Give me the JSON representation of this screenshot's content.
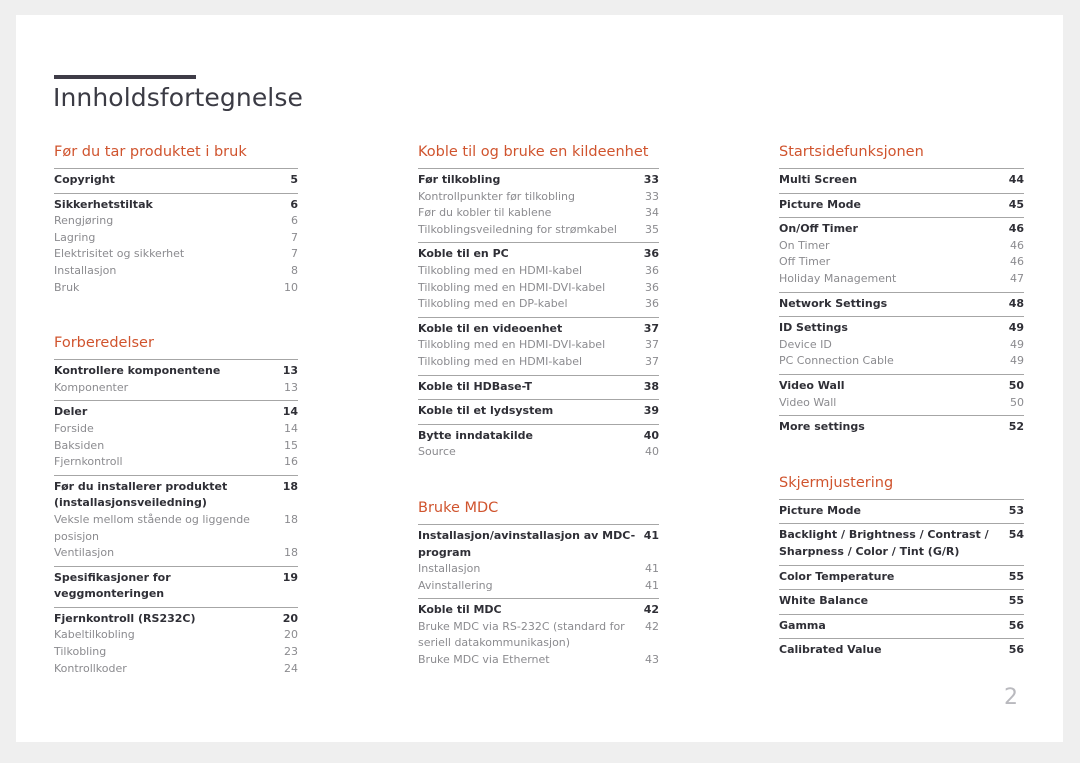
{
  "document": {
    "title": "Innholdsfortegnelse",
    "page_number": "2",
    "accent_color": "#d0542e",
    "rule_color": "#3e3c47"
  },
  "columns": [
    {
      "sections": [
        {
          "heading": "Før du tar produktet i bruk",
          "groups": [
            {
              "entries": [
                {
                  "label": "Copyright",
                  "page": "5",
                  "level": "main"
                }
              ]
            },
            {
              "entries": [
                {
                  "label": "Sikkerhetstiltak",
                  "page": "6",
                  "level": "main"
                },
                {
                  "label": "Rengjøring",
                  "page": "6",
                  "level": "sub"
                },
                {
                  "label": "Lagring",
                  "page": "7",
                  "level": "sub"
                },
                {
                  "label": "Elektrisitet og sikkerhet",
                  "page": "7",
                  "level": "sub"
                },
                {
                  "label": "Installasjon",
                  "page": "8",
                  "level": "sub"
                },
                {
                  "label": "Bruk",
                  "page": "10",
                  "level": "sub"
                }
              ]
            }
          ]
        },
        {
          "heading": "Forberedelser",
          "groups": [
            {
              "entries": [
                {
                  "label": "Kontrollere komponentene",
                  "page": "13",
                  "level": "main"
                },
                {
                  "label": "Komponenter",
                  "page": "13",
                  "level": "sub"
                }
              ]
            },
            {
              "entries": [
                {
                  "label": "Deler",
                  "page": "14",
                  "level": "main"
                },
                {
                  "label": "Forside",
                  "page": "14",
                  "level": "sub"
                },
                {
                  "label": "Baksiden",
                  "page": "15",
                  "level": "sub"
                },
                {
                  "label": "Fjernkontroll",
                  "page": "16",
                  "level": "sub"
                }
              ]
            },
            {
              "entries": [
                {
                  "label": "Før du installerer produktet (installasjonsveiledning)",
                  "page": "18",
                  "level": "main",
                  "wrap": true
                },
                {
                  "label": "Veksle mellom stående og liggende posisjon",
                  "page": "18",
                  "level": "sub"
                },
                {
                  "label": "Ventilasjon",
                  "page": "18",
                  "level": "sub"
                }
              ]
            },
            {
              "entries": [
                {
                  "label": "Spesifikasjoner for veggmonteringen",
                  "page": "19",
                  "level": "main"
                }
              ]
            },
            {
              "entries": [
                {
                  "label": "Fjernkontroll (RS232C)",
                  "page": "20",
                  "level": "main"
                },
                {
                  "label": "Kabeltilkobling",
                  "page": "20",
                  "level": "sub"
                },
                {
                  "label": "Tilkobling",
                  "page": "23",
                  "level": "sub"
                },
                {
                  "label": "Kontrollkoder",
                  "page": "24",
                  "level": "sub"
                }
              ]
            }
          ]
        }
      ]
    },
    {
      "sections": [
        {
          "heading": "Koble til og bruke en kildeenhet",
          "groups": [
            {
              "entries": [
                {
                  "label": "Før tilkobling",
                  "page": "33",
                  "level": "main"
                },
                {
                  "label": "Kontrollpunkter før tilkobling",
                  "page": "33",
                  "level": "sub"
                },
                {
                  "label": "Før du kobler til kablene",
                  "page": "34",
                  "level": "sub"
                },
                {
                  "label": "Tilkoblingsveiledning for strømkabel",
                  "page": "35",
                  "level": "sub"
                }
              ]
            },
            {
              "entries": [
                {
                  "label": "Koble til en PC",
                  "page": "36",
                  "level": "main"
                },
                {
                  "label": "Tilkobling med en HDMI-kabel",
                  "page": "36",
                  "level": "sub"
                },
                {
                  "label": "Tilkobling med en HDMI-DVI-kabel",
                  "page": "36",
                  "level": "sub"
                },
                {
                  "label": "Tilkobling med en DP-kabel",
                  "page": "36",
                  "level": "sub"
                }
              ]
            },
            {
              "entries": [
                {
                  "label": "Koble til en videoenhet",
                  "page": "37",
                  "level": "main"
                },
                {
                  "label": "Tilkobling med en HDMI-DVI-kabel",
                  "page": "37",
                  "level": "sub"
                },
                {
                  "label": "Tilkobling med en HDMI-kabel",
                  "page": "37",
                  "level": "sub"
                }
              ]
            },
            {
              "entries": [
                {
                  "label": "Koble til HDBase-T",
                  "page": "38",
                  "level": "main"
                }
              ]
            },
            {
              "entries": [
                {
                  "label": "Koble til et lydsystem",
                  "page": "39",
                  "level": "main"
                }
              ]
            },
            {
              "entries": [
                {
                  "label": "Bytte inndatakilde",
                  "page": "40",
                  "level": "main"
                },
                {
                  "label": "Source",
                  "page": "40",
                  "level": "sub"
                }
              ]
            }
          ]
        },
        {
          "heading": "Bruke MDC",
          "groups": [
            {
              "entries": [
                {
                  "label": "Installasjon/avinstallasjon av MDC-program",
                  "page": "41",
                  "level": "main"
                },
                {
                  "label": "Installasjon",
                  "page": "41",
                  "level": "sub"
                },
                {
                  "label": "Avinstallering",
                  "page": "41",
                  "level": "sub"
                }
              ]
            },
            {
              "entries": [
                {
                  "label": "Koble til MDC",
                  "page": "42",
                  "level": "main"
                },
                {
                  "label": "Bruke MDC via RS-232C (standard for seriell datakommunikasjon)",
                  "page": "42",
                  "level": "sub",
                  "wrap": true
                },
                {
                  "label": "Bruke MDC via Ethernet",
                  "page": "43",
                  "level": "sub"
                }
              ]
            }
          ]
        }
      ]
    },
    {
      "sections": [
        {
          "heading": "Startsidefunksjonen",
          "groups": [
            {
              "entries": [
                {
                  "label": "Multi Screen",
                  "page": "44",
                  "level": "main"
                }
              ]
            },
            {
              "entries": [
                {
                  "label": "Picture Mode",
                  "page": "45",
                  "level": "main"
                }
              ]
            },
            {
              "entries": [
                {
                  "label": "On/Off Timer",
                  "page": "46",
                  "level": "main"
                },
                {
                  "label": "On Timer",
                  "page": "46",
                  "level": "sub"
                },
                {
                  "label": "Off Timer",
                  "page": "46",
                  "level": "sub"
                },
                {
                  "label": "Holiday Management",
                  "page": "47",
                  "level": "sub"
                }
              ]
            },
            {
              "entries": [
                {
                  "label": "Network Settings",
                  "page": "48",
                  "level": "main"
                }
              ]
            },
            {
              "entries": [
                {
                  "label": "ID Settings",
                  "page": "49",
                  "level": "main"
                },
                {
                  "label": "Device ID",
                  "page": "49",
                  "level": "sub"
                },
                {
                  "label": "PC Connection Cable",
                  "page": "49",
                  "level": "sub"
                }
              ]
            },
            {
              "entries": [
                {
                  "label": "Video Wall",
                  "page": "50",
                  "level": "main"
                },
                {
                  "label": "Video Wall",
                  "page": "50",
                  "level": "sub"
                }
              ]
            },
            {
              "entries": [
                {
                  "label": "More settings",
                  "page": "52",
                  "level": "main"
                }
              ]
            }
          ]
        },
        {
          "heading": "Skjermjustering",
          "groups": [
            {
              "entries": [
                {
                  "label": "Picture Mode",
                  "page": "53",
                  "level": "main"
                }
              ]
            },
            {
              "entries": [
                {
                  "label": "Backlight / Brightness / Contrast / Sharpness / Color / Tint (G/R)",
                  "page": "54",
                  "level": "main",
                  "wrap": true
                }
              ]
            },
            {
              "entries": [
                {
                  "label": "Color Temperature",
                  "page": "55",
                  "level": "main"
                }
              ]
            },
            {
              "entries": [
                {
                  "label": "White Balance",
                  "page": "55",
                  "level": "main"
                }
              ]
            },
            {
              "entries": [
                {
                  "label": "Gamma",
                  "page": "56",
                  "level": "main"
                }
              ]
            },
            {
              "entries": [
                {
                  "label": "Calibrated Value",
                  "page": "56",
                  "level": "main"
                }
              ]
            }
          ]
        }
      ]
    }
  ]
}
